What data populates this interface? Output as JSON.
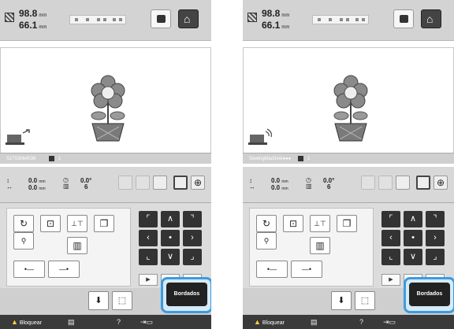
{
  "panels": [
    {
      "id": "left",
      "size": {
        "width": "98.8",
        "height": "66.1",
        "unit": "mm"
      },
      "status_text": "S2703064038",
      "status_extra": "1",
      "info": {
        "x": "0.0",
        "y": "0.0",
        "unit": "mm",
        "count": "6",
        "angle": "0.0°"
      },
      "action_label": "Bordados",
      "lock_label": "Bloquear"
    },
    {
      "id": "right",
      "size": {
        "width": "98.8",
        "height": "66.1",
        "unit": "mm"
      },
      "status_text": "SewingMachine●●●",
      "status_extra": "1",
      "info": {
        "x": "0.0",
        "y": "0.0",
        "unit": "mm",
        "count": "6",
        "angle": "0.0°"
      },
      "action_label": "Bordados",
      "lock_label": "Bloquear"
    }
  ],
  "icons": {
    "home": "home-icon",
    "camera": "camera-icon",
    "rotate": "rotate-icon",
    "zoom": "zoom-icon",
    "lock": "warning-icon"
  },
  "colors": {
    "highlight": "#3b9be0",
    "pad": "#333333",
    "flower": "#8a8a8a"
  }
}
